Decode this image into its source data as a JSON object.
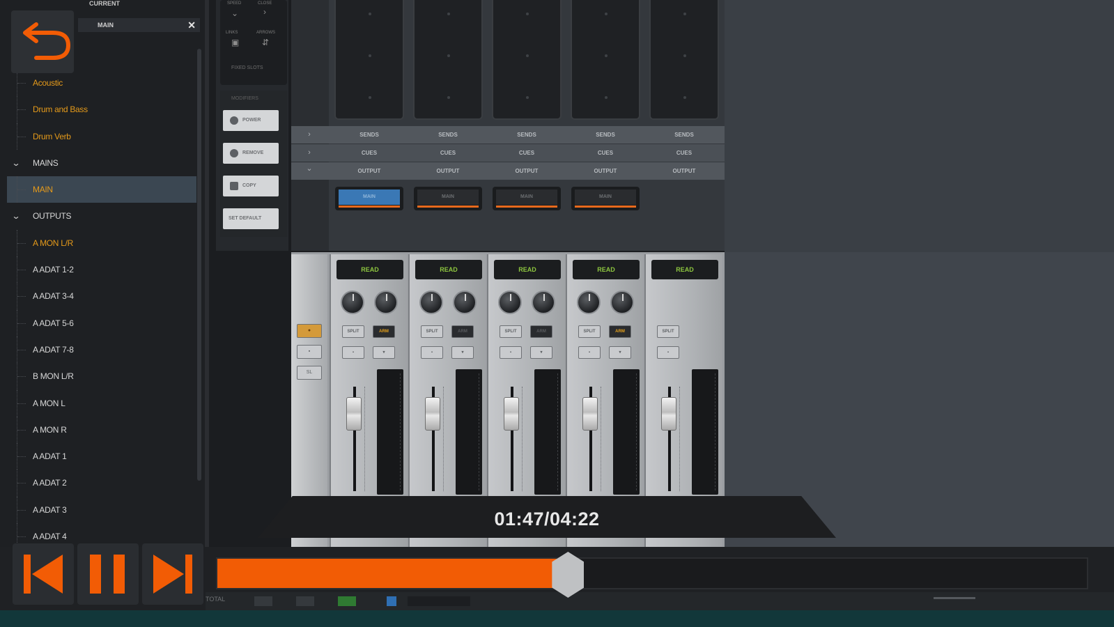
{
  "browser": {
    "header": "CURRENT",
    "field_value": "MAIN",
    "items": [
      {
        "label": "Acoustic"
      },
      {
        "label": "Drum and Bass"
      },
      {
        "label": "Drum Verb"
      },
      {
        "label": "MAINS"
      },
      {
        "label": "MAIN"
      },
      {
        "label": "OUTPUTS"
      },
      {
        "label": "A MON L/R"
      },
      {
        "label": "A ADAT 1-2"
      },
      {
        "label": "A ADAT 3-4"
      },
      {
        "label": "A ADAT 5-6"
      },
      {
        "label": "A ADAT 7-8"
      },
      {
        "label": "B MON L/R"
      },
      {
        "label": "A MON L"
      },
      {
        "label": "A MON R"
      },
      {
        "label": "A ADAT 1"
      },
      {
        "label": "A ADAT 2"
      },
      {
        "label": "A ADAT 3"
      },
      {
        "label": "A ADAT 4"
      }
    ]
  },
  "side_column": {
    "top_labels": [
      "SPEED",
      "CLOSE",
      "LINKS",
      "ARROWS"
    ],
    "top_text": "FIXED SLOTS",
    "section_label": "MODIFIERS",
    "buttons": [
      {
        "label": "POWER"
      },
      {
        "label": "REMOVE"
      },
      {
        "label": "COPY"
      },
      {
        "label": "SET DEFAULT"
      }
    ]
  },
  "mixer": {
    "rows": [
      "SENDS",
      "CUES",
      "OUTPUT"
    ],
    "row_arrows": [
      "›",
      "›",
      "⌄"
    ],
    "output_label": "MAIN",
    "strips": [
      {
        "mode": "READ",
        "split": "SPLIT",
        "arm": "ARM",
        "arm_lit": true
      },
      {
        "mode": "READ",
        "split": "SPLIT",
        "arm": "ARM",
        "arm_lit": false
      },
      {
        "mode": "READ",
        "split": "SPLIT",
        "arm": "ARM",
        "arm_lit": false
      },
      {
        "mode": "READ",
        "split": "SPLIT",
        "arm": "ARM",
        "arm_lit": true
      },
      {
        "mode": "READ",
        "split": "SPLIT",
        "arm": "",
        "arm_lit": false
      }
    ],
    "left_strip_label": "SL"
  },
  "player": {
    "time": "01:47/04:22",
    "progress": 0.3945,
    "status_label": "TOTAL"
  },
  "colors": {
    "accent_orange": "#f25c05",
    "folder_orange": "#e59a1a",
    "read_green": "#8dc63f",
    "output_active_blue": "#3a78b5"
  },
  "icons": {
    "back": "undo-arrow-icon",
    "previous": "skip-previous-icon",
    "pause": "pause-icon",
    "next": "skip-next-icon",
    "close": "close-icon"
  }
}
